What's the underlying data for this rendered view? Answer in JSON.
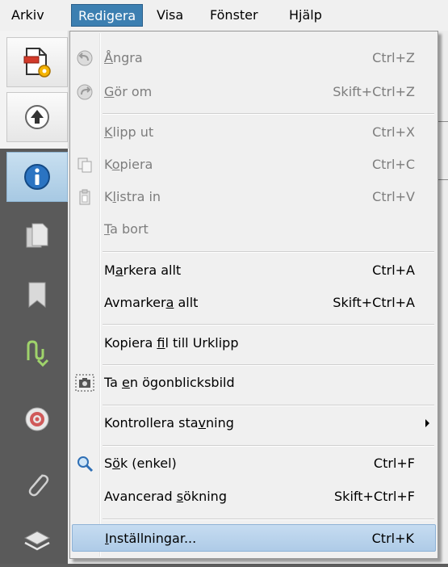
{
  "menubar": {
    "items": [
      {
        "label": "Arkiv"
      },
      {
        "label": "Redigera",
        "active": true
      },
      {
        "label": "Visa"
      },
      {
        "label": "Fönster"
      },
      {
        "label": "Hjälp"
      }
    ]
  },
  "rail": {
    "tools": [
      {
        "icon": "document-settings-icon"
      },
      {
        "icon": "up-arrow-icon"
      },
      {
        "icon": "info-icon"
      },
      {
        "icon": "pages-icon"
      },
      {
        "icon": "bookmark-icon"
      },
      {
        "icon": "signature-icon"
      },
      {
        "icon": "target-icon"
      },
      {
        "icon": "paperclip-icon"
      },
      {
        "icon": "layers-icon"
      }
    ]
  },
  "menu": {
    "undo": {
      "pre": "",
      "ul": "Å",
      "post": "ngra",
      "shortcut": "Ctrl+Z",
      "icon": "undo-icon"
    },
    "redo": {
      "pre": "",
      "ul": "G",
      "post": "ör om",
      "shortcut": "Skift+Ctrl+Z",
      "icon": "redo-icon"
    },
    "cut": {
      "pre": "",
      "ul": "K",
      "post": "lipp ut",
      "shortcut": "Ctrl+X"
    },
    "copy": {
      "pre": "K",
      "ul": "o",
      "post": "piera",
      "shortcut": "Ctrl+C",
      "icon": "copy-icon"
    },
    "paste": {
      "pre": "K",
      "ul": "l",
      "post": "istra in",
      "shortcut": "Ctrl+V",
      "icon": "paste-icon"
    },
    "delete": {
      "pre": "",
      "ul": "T",
      "post": "a bort",
      "shortcut": ""
    },
    "select_all": {
      "pre": "M",
      "ul": "a",
      "post": "rkera allt",
      "shortcut": "Ctrl+A"
    },
    "deselect_all": {
      "pre": "Avmarker",
      "ul": "a",
      "post": " allt",
      "shortcut": "Skift+Ctrl+A"
    },
    "copy_file": {
      "pre": "Kopiera ",
      "ul": "f",
      "post": "il till Urklipp",
      "shortcut": ""
    },
    "snapshot": {
      "pre": "Ta ",
      "ul": "e",
      "post": "n ögonblicksbild",
      "shortcut": "",
      "icon": "camera-icon"
    },
    "spelling": {
      "pre": "Kontrollera sta",
      "ul": "v",
      "post": "ning",
      "shortcut": ""
    },
    "search": {
      "pre": "S",
      "ul": "ö",
      "post": "k (enkel)",
      "shortcut": "Ctrl+F",
      "icon": "search-icon"
    },
    "advanced_search": {
      "pre": "Avancerad ",
      "ul": "s",
      "post": "ökning",
      "shortcut": "Skift+Ctrl+F"
    },
    "preferences": {
      "pre": "",
      "ul": "I",
      "post": "nställningar...",
      "shortcut": "Ctrl+K"
    }
  }
}
